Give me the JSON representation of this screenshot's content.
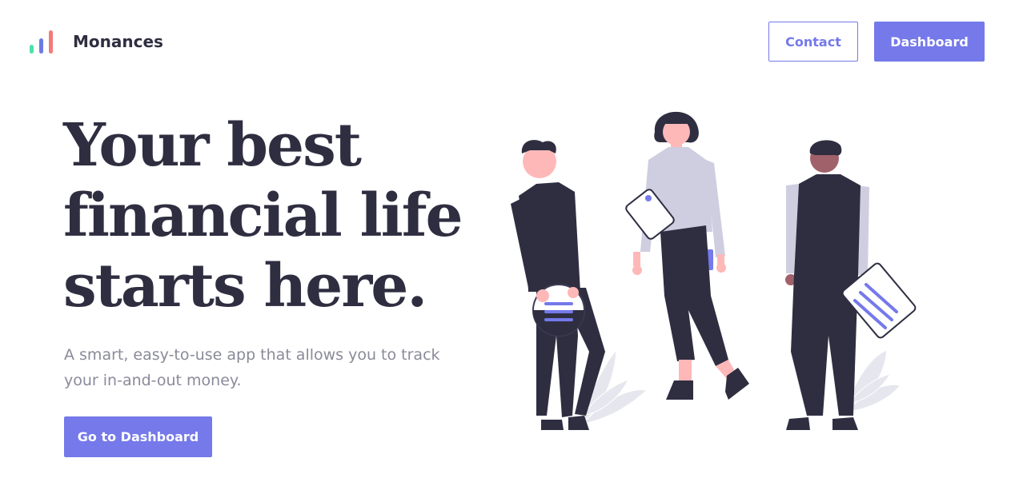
{
  "header": {
    "brand_name": "Monances",
    "logo_icon": "bar-chart-icon",
    "contact_label": "Contact",
    "dashboard_label": "Dashboard"
  },
  "hero": {
    "title_lines": [
      "Your best",
      "financial life",
      "starts here."
    ],
    "subtitle_lines": [
      "A smart, easy-to-use app that allows you to track",
      "your in-and-out money."
    ],
    "cta_label": "Go to Dashboard"
  },
  "colors": {
    "accent": "#7579ea",
    "text_dark": "#2f2e41",
    "text_muted": "#8a8a9a",
    "logo_green": "#4ee0a8",
    "logo_blue": "#6c7ae6",
    "logo_red": "#f27a7a",
    "skin_light": "#ffb8b8",
    "skin_dark": "#a0616a",
    "shirt_grey": "#cfcde0",
    "plant_grey": "#e6e6ee"
  },
  "illustration": {
    "name": "three-people-illustration",
    "icons": [
      "document-icon",
      "tablet-icon",
      "phone-icon",
      "pie-chart-icon",
      "plant-icon"
    ]
  }
}
